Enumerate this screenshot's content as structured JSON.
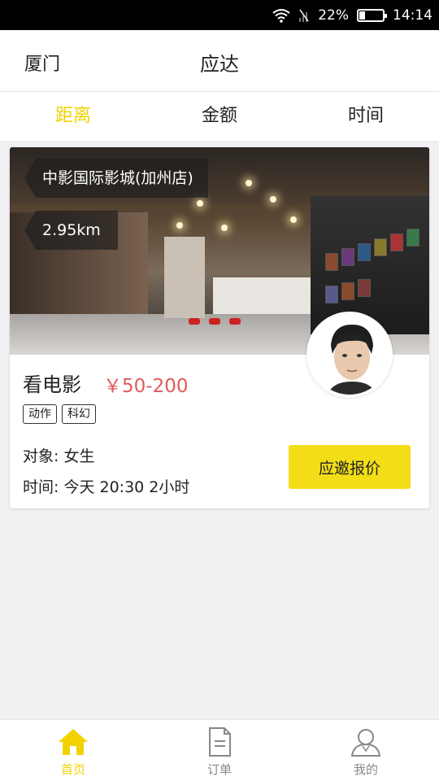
{
  "status_bar": {
    "battery": "22%",
    "time": "14:14",
    "battery_level": 0.22
  },
  "header": {
    "city": "厦门",
    "title": "应达"
  },
  "sort_tabs": [
    {
      "label": "距离",
      "active": true
    },
    {
      "label": "金额",
      "active": false
    },
    {
      "label": "时间",
      "active": false
    }
  ],
  "card": {
    "cinema_name": "中影国际影城(加州店)",
    "distance": "2.95km",
    "activity": "看电影",
    "price": "￥50-200",
    "tags": [
      "动作",
      "科幻"
    ],
    "target_label": "对象:",
    "target_value": "女生",
    "time_label": "时间:",
    "time_value": "今天 20:30  2小时",
    "quote_button": "应邀报价"
  },
  "bottom_nav": [
    {
      "label": "首页",
      "icon": "home-icon",
      "active": true
    },
    {
      "label": "订单",
      "icon": "order-icon",
      "active": false
    },
    {
      "label": "我的",
      "icon": "profile-icon",
      "active": false
    }
  ],
  "colors": {
    "accent": "#f1d200",
    "price": "#e05a5a",
    "button": "#f3dd17",
    "background": "#f1f0f3"
  }
}
